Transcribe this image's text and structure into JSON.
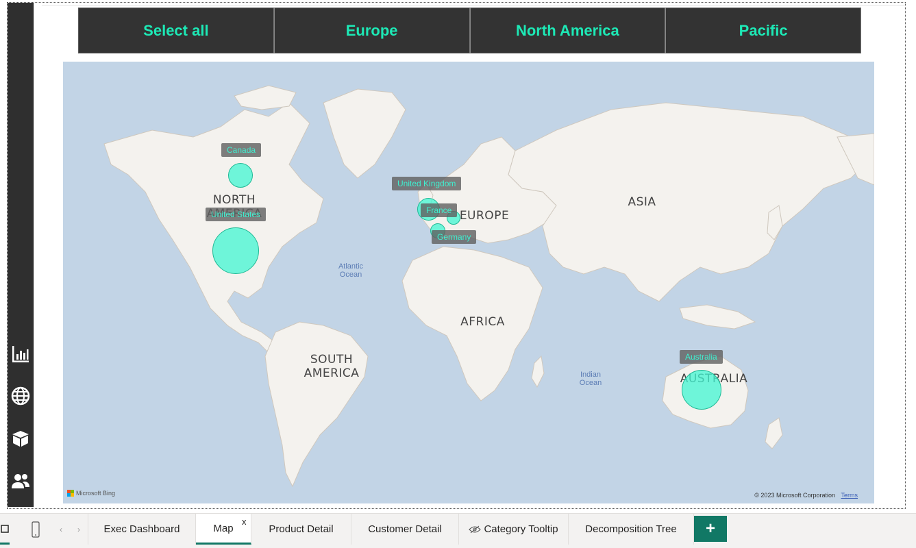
{
  "slicer": {
    "buttons": [
      "Select all",
      "Europe",
      "North America",
      "Pacific"
    ],
    "text_color": "#1de9b6",
    "background": "#333333"
  },
  "left_nav": {
    "icons": [
      "bar-chart-icon",
      "globe-icon",
      "box-icon",
      "people-icon"
    ]
  },
  "map": {
    "continent_labels": {
      "north_america": "NORTH\nAMERICA",
      "europe": "EUROPE",
      "asia": "ASIA",
      "africa": "AFRICA",
      "south_america": "SOUTH\nAMERICA",
      "australia": "AUSTRALIA"
    },
    "ocean_labels": {
      "atlantic": "Atlantic\nOcean",
      "indian": "Indian\nOcean"
    },
    "bubbles": [
      {
        "country": "Canada",
        "size": "small"
      },
      {
        "country": "United States",
        "size": "large"
      },
      {
        "country": "United Kingdom",
        "size": "small"
      },
      {
        "country": "France",
        "size": "small"
      },
      {
        "country": "Germany",
        "size": "small"
      },
      {
        "country": "Australia",
        "size": "medium"
      }
    ],
    "bubble_color": "#41f5d2",
    "ocean_color": "#c2d4e6",
    "land_color": "#f4f2ee",
    "attribution": "Microsoft Bing",
    "copyright": "© 2023 Microsoft Corporation",
    "terms": "Terms"
  },
  "tabs": {
    "items": [
      "Exec Dashboard",
      "Map",
      "Product Detail",
      "Customer Detail",
      "Category Tooltip",
      "Decomposition Tree"
    ],
    "active": "Map",
    "close_glyph": "x",
    "add_glyph": "+",
    "accent": "#117865"
  }
}
